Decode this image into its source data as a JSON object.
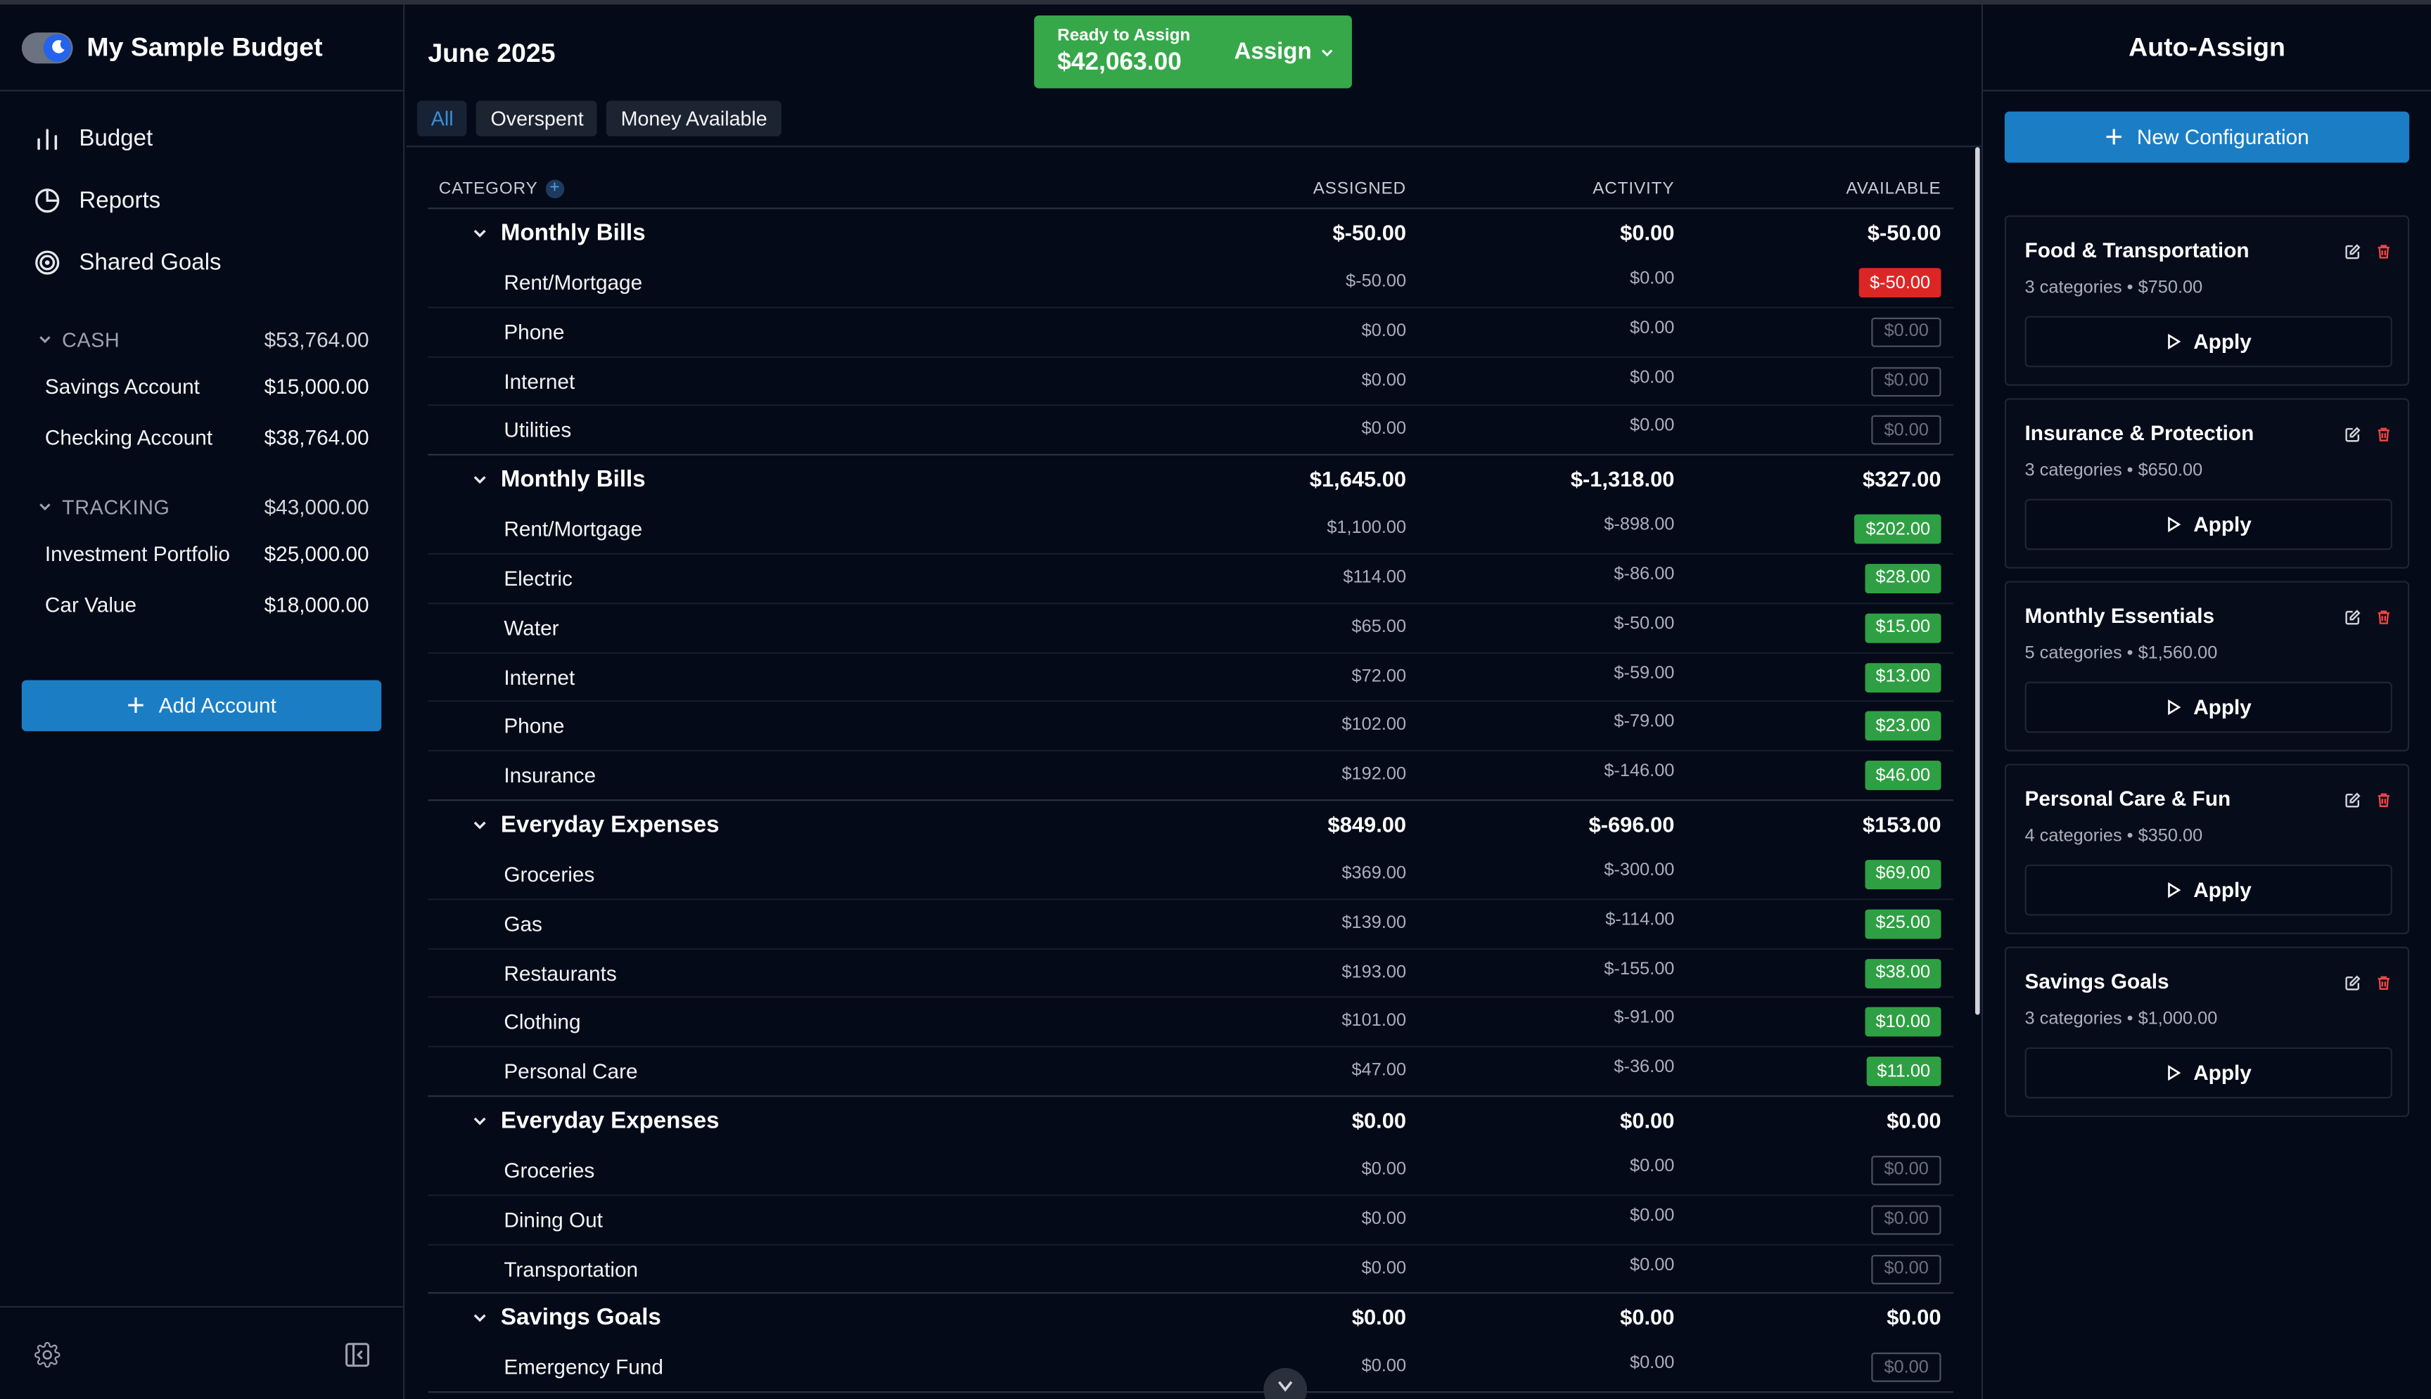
{
  "sidebar": {
    "budget_name": "My Sample Budget",
    "nav": [
      {
        "label": "Budget",
        "icon": "bar-chart-icon"
      },
      {
        "label": "Reports",
        "icon": "pie-chart-icon"
      },
      {
        "label": "Shared Goals",
        "icon": "target-icon"
      }
    ],
    "groups": [
      {
        "label": "CASH",
        "total": "$53,764.00",
        "accounts": [
          {
            "name": "Savings Account",
            "balance": "$15,000.00"
          },
          {
            "name": "Checking Account",
            "balance": "$38,764.00"
          }
        ]
      },
      {
        "label": "TRACKING",
        "total": "$43,000.00",
        "accounts": [
          {
            "name": "Investment Portfolio",
            "balance": "$25,000.00"
          },
          {
            "name": "Car Value",
            "balance": "$18,000.00"
          }
        ]
      }
    ],
    "add_account_label": "Add Account"
  },
  "header": {
    "month": "June 2025",
    "ready_label": "Ready to Assign",
    "ready_amount": "$42,063.00",
    "assign_label": "Assign",
    "filters": [
      "All",
      "Overspent",
      "Money Available"
    ],
    "active_filter": "All"
  },
  "table": {
    "columns": {
      "category": "CATEGORY",
      "assigned": "ASSIGNED",
      "activity": "ACTIVITY",
      "available": "AVAILABLE"
    },
    "groups": [
      {
        "name": "Monthly Bills",
        "assigned": "$-50.00",
        "activity": "$0.00",
        "available": "$-50.00",
        "rows": [
          {
            "name": "Rent/Mortgage",
            "assigned": "$-50.00",
            "activity": "$0.00",
            "available": "$-50.00",
            "status": "neg"
          },
          {
            "name": "Phone",
            "assigned": "$0.00",
            "activity": "$0.00",
            "available": "$0.00",
            "status": "zero"
          },
          {
            "name": "Internet",
            "assigned": "$0.00",
            "activity": "$0.00",
            "available": "$0.00",
            "status": "zero"
          },
          {
            "name": "Utilities",
            "assigned": "$0.00",
            "activity": "$0.00",
            "available": "$0.00",
            "status": "zero"
          }
        ]
      },
      {
        "name": "Monthly Bills",
        "assigned": "$1,645.00",
        "activity": "$-1,318.00",
        "available": "$327.00",
        "rows": [
          {
            "name": "Rent/Mortgage",
            "assigned": "$1,100.00",
            "activity": "$-898.00",
            "available": "$202.00",
            "status": "pos"
          },
          {
            "name": "Electric",
            "assigned": "$114.00",
            "activity": "$-86.00",
            "available": "$28.00",
            "status": "pos"
          },
          {
            "name": "Water",
            "assigned": "$65.00",
            "activity": "$-50.00",
            "available": "$15.00",
            "status": "pos"
          },
          {
            "name": "Internet",
            "assigned": "$72.00",
            "activity": "$-59.00",
            "available": "$13.00",
            "status": "pos"
          },
          {
            "name": "Phone",
            "assigned": "$102.00",
            "activity": "$-79.00",
            "available": "$23.00",
            "status": "pos"
          },
          {
            "name": "Insurance",
            "assigned": "$192.00",
            "activity": "$-146.00",
            "available": "$46.00",
            "status": "pos"
          }
        ]
      },
      {
        "name": "Everyday Expenses",
        "assigned": "$849.00",
        "activity": "$-696.00",
        "available": "$153.00",
        "rows": [
          {
            "name": "Groceries",
            "assigned": "$369.00",
            "activity": "$-300.00",
            "available": "$69.00",
            "status": "pos"
          },
          {
            "name": "Gas",
            "assigned": "$139.00",
            "activity": "$-114.00",
            "available": "$25.00",
            "status": "pos"
          },
          {
            "name": "Restaurants",
            "assigned": "$193.00",
            "activity": "$-155.00",
            "available": "$38.00",
            "status": "pos"
          },
          {
            "name": "Clothing",
            "assigned": "$101.00",
            "activity": "$-91.00",
            "available": "$10.00",
            "status": "pos"
          },
          {
            "name": "Personal Care",
            "assigned": "$47.00",
            "activity": "$-36.00",
            "available": "$11.00",
            "status": "pos"
          }
        ]
      },
      {
        "name": "Everyday Expenses",
        "assigned": "$0.00",
        "activity": "$0.00",
        "available": "$0.00",
        "rows": [
          {
            "name": "Groceries",
            "assigned": "$0.00",
            "activity": "$0.00",
            "available": "$0.00",
            "status": "zero"
          },
          {
            "name": "Dining Out",
            "assigned": "$0.00",
            "activity": "$0.00",
            "available": "$0.00",
            "status": "zero"
          },
          {
            "name": "Transportation",
            "assigned": "$0.00",
            "activity": "$0.00",
            "available": "$0.00",
            "status": "zero"
          }
        ]
      },
      {
        "name": "Savings Goals",
        "assigned": "$0.00",
        "activity": "$0.00",
        "available": "$0.00",
        "rows": [
          {
            "name": "Emergency Fund",
            "assigned": "$0.00",
            "activity": "$0.00",
            "available": "$0.00",
            "status": "zero"
          }
        ]
      }
    ]
  },
  "auto_assign": {
    "title": "Auto-Assign",
    "new_config_label": "New Configuration",
    "apply_label": "Apply",
    "configs": [
      {
        "name": "Food & Transportation",
        "summary": "3 categories • $750.00"
      },
      {
        "name": "Insurance & Protection",
        "summary": "3 categories • $650.00"
      },
      {
        "name": "Monthly Essentials",
        "summary": "5 categories • $1,560.00"
      },
      {
        "name": "Personal Care & Fun",
        "summary": "4 categories • $350.00"
      },
      {
        "name": "Savings Goals",
        "summary": "3 categories • $1,000.00"
      }
    ]
  },
  "colors": {
    "accent_blue": "#1b7ec5",
    "positive_green": "#2ea043",
    "negative_red": "#dc2626",
    "ready_green": "#36a84a"
  }
}
